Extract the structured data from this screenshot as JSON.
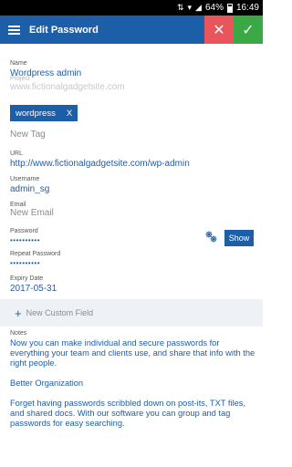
{
  "status_bar": {
    "battery": "64%",
    "time": "16:49"
  },
  "app_bar": {
    "title": "Edit Password"
  },
  "fields": {
    "name": {
      "label": "Name",
      "value": "Wordpress admin"
    },
    "project": {
      "label": "Project",
      "placeholder": "www.fictionalgadgetsite.com"
    },
    "tag": {
      "value": "wordpress",
      "remove": "X"
    },
    "new_tag": {
      "placeholder": "New Tag"
    },
    "url": {
      "label": "URL",
      "value": "http://www.fictionalgadgetsite.com/wp-admin"
    },
    "username": {
      "label": "Username",
      "value": "admin_sg"
    },
    "email": {
      "label": "Email",
      "placeholder": "New Email"
    },
    "password": {
      "label": "Password",
      "value": "••••••••••",
      "show_label": "Show"
    },
    "repeat_password": {
      "label": "Repeat Password",
      "value": "••••••••••"
    },
    "expiry": {
      "label": "Expiry Date",
      "value": "2017-05-31"
    }
  },
  "custom_field": {
    "label": "New Custom Field"
  },
  "notes": {
    "label": "Notes",
    "paragraphs": [
      "Now you can make individual and secure passwords for everything your team and clients use, and share that info with the right people.",
      "Better Organization",
      "Forget having passwords scribbled down on post-its, TXT files, and shared docs. With our software you can group and tag passwords for easy searching."
    ]
  },
  "colors": {
    "primary": "#1d5ea8",
    "cancel": "#e8555b",
    "confirm": "#3aa845"
  },
  "icons": [
    "hamburger-icon",
    "close-icon",
    "check-icon",
    "gear-icon",
    "plus-icon",
    "wifi-icon",
    "signal-icon",
    "battery-icon"
  ]
}
